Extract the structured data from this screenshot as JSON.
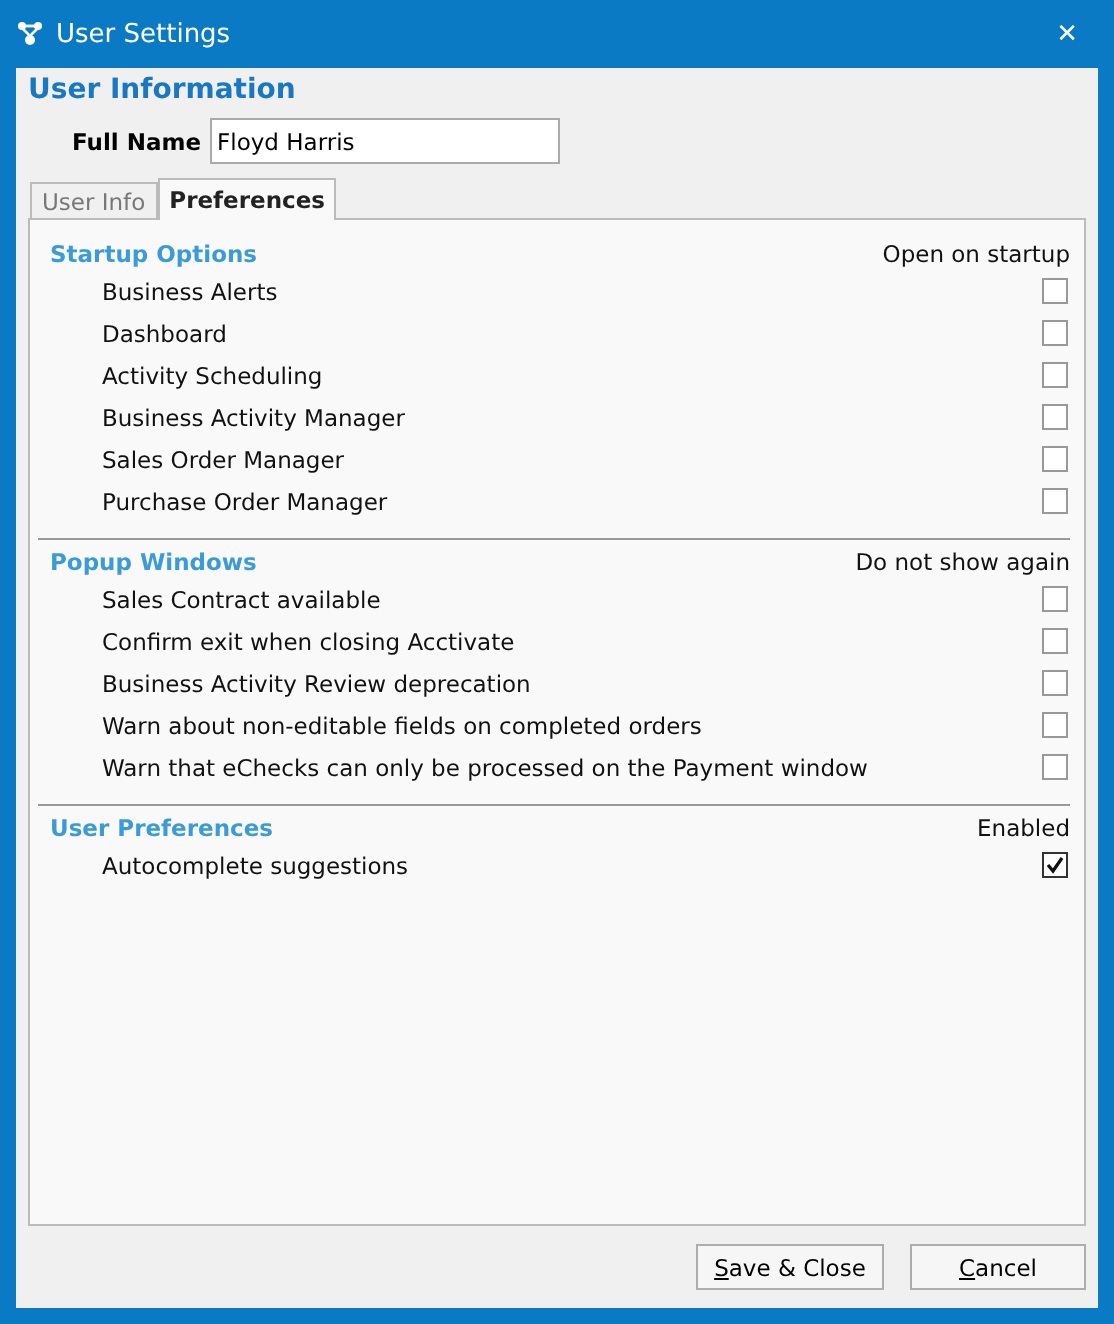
{
  "window": {
    "title": "User Settings",
    "close": "✕"
  },
  "heading": "User Information",
  "full_name": {
    "label": "Full Name",
    "value": "Floyd Harris"
  },
  "tabs": [
    {
      "label": "User Info",
      "selected": false
    },
    {
      "label": "Preferences",
      "selected": true
    }
  ],
  "sections": [
    {
      "title": "Startup Options",
      "column": "Open on startup",
      "items": [
        {
          "label": "Business Alerts",
          "checked": false
        },
        {
          "label": "Dashboard",
          "checked": false
        },
        {
          "label": "Activity Scheduling",
          "checked": false
        },
        {
          "label": "Business Activity Manager",
          "checked": false
        },
        {
          "label": "Sales Order Manager",
          "checked": false
        },
        {
          "label": "Purchase Order Manager",
          "checked": false
        }
      ]
    },
    {
      "title": "Popup Windows",
      "column": "Do not show again",
      "items": [
        {
          "label": "Sales Contract available",
          "checked": false
        },
        {
          "label": "Confirm exit when closing Acctivate",
          "checked": false
        },
        {
          "label": "Business Activity Review deprecation",
          "checked": false
        },
        {
          "label": "Warn about non-editable fields on completed orders",
          "checked": false
        },
        {
          "label": "Warn that eChecks can only be processed on the Payment window",
          "checked": false
        }
      ]
    },
    {
      "title": "User Preferences",
      "column": "Enabled",
      "items": [
        {
          "label": "Autocomplete suggestions",
          "checked": true
        }
      ]
    }
  ],
  "buttons": [
    "Save & Close",
    "Cancel"
  ]
}
